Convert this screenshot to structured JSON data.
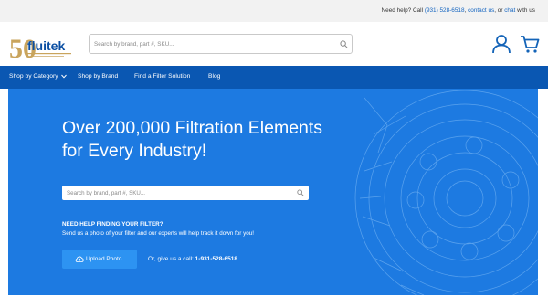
{
  "topbar": {
    "need_help": "Need help? Call",
    "phone": "(931) 528-6518",
    "comma": ",",
    "contact": "contact us",
    "or": ", or",
    "chat": "chat",
    "with_us": "with us"
  },
  "logo": {
    "number": "50",
    "text": "fluitek"
  },
  "search": {
    "placeholder": "Search by brand, part #, SKU..."
  },
  "header_icons": [
    "account-icon",
    "cart-icon"
  ],
  "nav": {
    "items": [
      {
        "label": "Shop by Category",
        "dropdown": true
      },
      {
        "label": "Shop by Brand"
      },
      {
        "label": "Find a Filter Solution"
      },
      {
        "label": "Blog"
      }
    ]
  },
  "hero": {
    "title_line1": "Over 200,000 Filtration Elements",
    "title_line2": "for Every Industry!",
    "search_placeholder": "Search by brand, part #, SKU...",
    "need_help": "NEED HELP FINDING YOUR FILTER?",
    "send_photo": "Send us a photo of your filter and our experts will help track it down for you!",
    "upload_label": "Upload Photo",
    "call_prefix": "Or, give us a call:",
    "call_phone": "1-931-528-6518"
  },
  "colors": {
    "nav_bg": "#0a57b2",
    "hero_bg": "#1d7ae1",
    "upload_bg": "#2d93f2",
    "link": "#1565c0",
    "logo_gold": "#c9a45c",
    "logo_blue": "#0b4fa3"
  }
}
